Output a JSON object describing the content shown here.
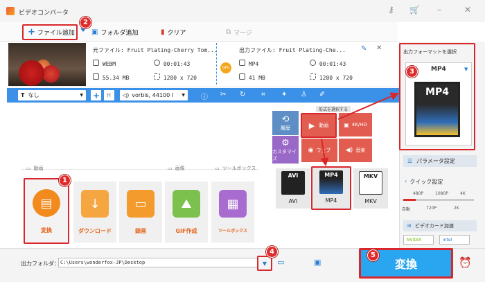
{
  "window": {
    "title": "ビデオコンバータ"
  },
  "toolbar": {
    "add_file": "ファイル追加",
    "add_folder": "フォルダ追加",
    "clear": "クリア",
    "merge": "マージ"
  },
  "file": {
    "source_name": "元ファイル: Fruit Plating-Cherry Tom...",
    "source_format": "WEBM",
    "source_duration": "00:01:43",
    "source_size": "55.34 MB",
    "source_resolution": "1280 x 720",
    "output_name": "出力ファイル: Fruit Plating-Che...",
    "output_format": "MP4",
    "output_duration": "00:01:43",
    "output_size": "41 MB",
    "output_resolution": "1280 x 720",
    "gpu": "GPU"
  },
  "edit_bar": {
    "subtitle": "なし",
    "audio": "vorbis, 44100 l"
  },
  "format_panel": {
    "header": "形式を選択する",
    "categories": [
      {
        "key": "history",
        "label": "履歴"
      },
      {
        "key": "video",
        "label": "動画"
      },
      {
        "key": "4k",
        "label": "4K/HD"
      },
      {
        "key": "custom",
        "label": "カスタマイズ"
      },
      {
        "key": "web",
        "label": "ウェブ"
      },
      {
        "key": "music",
        "label": "音楽"
      }
    ],
    "formats": [
      {
        "label": "AVI"
      },
      {
        "label": "MP4"
      },
      {
        "label": "MKV"
      }
    ]
  },
  "sections": {
    "video": "動画",
    "image": "画像",
    "toolbox": "ツールボックス"
  },
  "tools": [
    {
      "label": "変換",
      "color": "#f28a1e"
    },
    {
      "label": "ダウンロード",
      "color": "#f5a640"
    },
    {
      "label": "録画",
      "color": "#f39b2d"
    },
    {
      "label": "GIF作成",
      "color": "#7cc04e"
    },
    {
      "label": "ツールボックス",
      "color": "#a86bd0"
    }
  ],
  "right_panel": {
    "title": "出力フォーマットを選択",
    "selected_format": "MP4",
    "params": "パラメータ設定",
    "quick": "クイック設定",
    "quick_top_labels": [
      "480P",
      "1080P",
      "4K"
    ],
    "quick_bottom_labels": [
      "自動",
      "720P",
      "2K"
    ],
    "gpu_accel": "ビデオカード加速",
    "gpu_vendors": [
      "NVIDIA",
      "intel"
    ]
  },
  "bottom": {
    "folder_label": "出力フォルダ：",
    "folder_path": "C:\\Users\\wonderfox-JP\\Desktop",
    "convert": "変換"
  },
  "badges": [
    "1",
    "2",
    "3",
    "4",
    "5"
  ],
  "colors": {
    "accent_blue": "#3b91e8",
    "highlight_red": "#d8262b",
    "orange": "#f28a1e",
    "format_red": "#e25d4f"
  }
}
